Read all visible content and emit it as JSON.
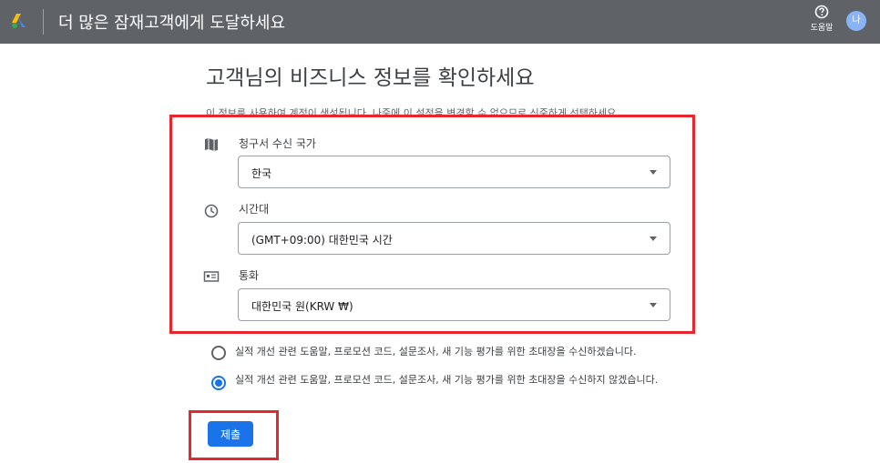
{
  "header": {
    "title": "더 많은 잠재고객에게 도달하세요",
    "help_label": "도움말",
    "avatar_initial": "나"
  },
  "main": {
    "heading": "고객님의 비즈니스 정보를 확인하세요",
    "intro": "이 정보를 사용하여 계정이 생성됩니다. 나중에 이 설정을 변경할 수 없으므로 신중하게 선택하세요.",
    "fields": [
      {
        "icon": "map-icon",
        "label": "청구서 수신 국가",
        "value": "한국"
      },
      {
        "icon": "clock-icon",
        "label": "시간대",
        "value": "(GMT+09:00) 대한민국 시간"
      },
      {
        "icon": "currency-icon",
        "label": "통화",
        "value": "대한민국 원(KRW ₩)"
      }
    ],
    "options": [
      {
        "label": "실적 개선 관련 도움말, 프로모션 코드, 설문조사, 새 기능 평가를 위한 초대장을 수신하겠습니다.",
        "selected": false
      },
      {
        "label": "실적 개선 관련 도움말, 프로모션 코드, 설문조사, 새 기능 평가를 위한 초대장을 수신하지 않겠습니다.",
        "selected": true
      }
    ],
    "submit_label": "제출"
  },
  "colors": {
    "topbar": "#5f6368",
    "accent": "#1a73e8",
    "highlight": "#e8262e"
  }
}
